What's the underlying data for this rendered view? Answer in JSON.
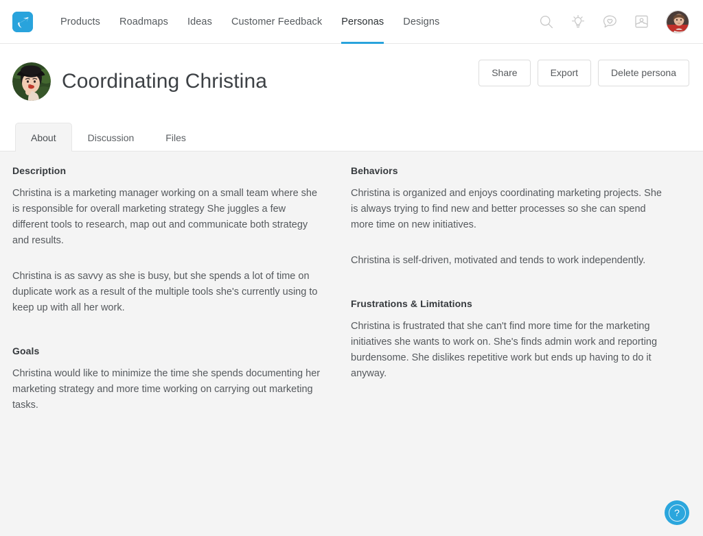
{
  "topnav": {
    "logo_name": "aha-logo",
    "links": [
      {
        "label": "Products",
        "active": false
      },
      {
        "label": "Roadmaps",
        "active": false
      },
      {
        "label": "Ideas",
        "active": false
      },
      {
        "label": "Customer Feedback",
        "active": false
      },
      {
        "label": "Personas",
        "active": true
      },
      {
        "label": "Designs",
        "active": false
      }
    ],
    "icons": [
      {
        "name": "search-icon"
      },
      {
        "name": "lightbulb-icon"
      },
      {
        "name": "comment-heart-icon"
      },
      {
        "name": "inbox-person-icon"
      }
    ],
    "avatar_name": "user-avatar"
  },
  "page": {
    "avatar_name": "persona-avatar",
    "title": "Coordinating Christina",
    "actions": [
      {
        "label": "Share",
        "name": "share-button"
      },
      {
        "label": "Export",
        "name": "export-button"
      },
      {
        "label": "Delete persona",
        "name": "delete-persona-button"
      }
    ]
  },
  "tabs": [
    {
      "label": "About",
      "active": true
    },
    {
      "label": "Discussion",
      "active": false
    },
    {
      "label": "Files",
      "active": false
    }
  ],
  "sections": {
    "description": {
      "heading": "Description",
      "paragraph_1": "Christina is a marketing manager working on a small team where she is responsible for overall marketing strategy She juggles a few different tools to research, map out and communicate both strategy and results.",
      "paragraph_2": "Christina is as savvy as she is busy, but she spends a lot of time on duplicate work as a result of the multiple tools she's currently using to keep up with all her work."
    },
    "behaviors": {
      "heading": "Behaviors",
      "paragraph_1": "Christina is organized and enjoys coordinating marketing projects. She is always trying to find new and better processes so she can spend more time on new initiatives.",
      "paragraph_2": "Christina is self-driven, motivated and tends to work independently."
    },
    "goals": {
      "heading": "Goals",
      "paragraph_1": "Christina would like to minimize the time she spends documenting her marketing strategy and more time working on carrying out marketing tasks."
    },
    "frustrations": {
      "heading": "Frustrations & Limitations",
      "paragraph_1": "Christina is frustrated that she can't find more time for the marketing initiatives she wants to work on. She's finds admin work and reporting burdensome. She dislikes repetitive work but ends up having to do it anyway."
    }
  },
  "help": {
    "label": "?",
    "name": "help-button"
  },
  "colors": {
    "accent": "#29a3dc",
    "page_background": "#f4f4f4",
    "panel_background": "#ffffff",
    "text": "#55595d",
    "heading": "#35393d",
    "border": "#e6e6e6"
  }
}
